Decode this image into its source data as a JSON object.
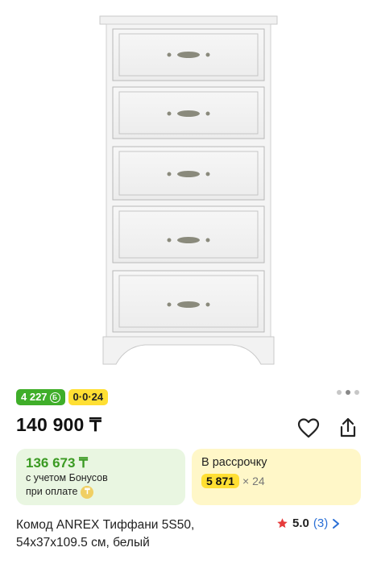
{
  "product": {
    "image_alt": "Комод ANREX Тиффани 5S50",
    "bonus_badge": "4 227",
    "installment_badge": "0·0·24",
    "price": "140 900 ₸",
    "title": "Комод ANREX Тиффани 5S50, 54x37x109.5 см, белый"
  },
  "bonus_card": {
    "price": "136 673 ₸",
    "line1": "с учетом Бонусов",
    "line2": "при оплате"
  },
  "installment_card": {
    "title": "В рассрочку",
    "amount": "5 871",
    "months": "× 24"
  },
  "rating": {
    "score": "5.0",
    "count": "(3)"
  },
  "gallery": {
    "total": 3,
    "active": 1
  },
  "colors": {
    "green": "#3fae29",
    "yellow": "#ffdf33",
    "star": "#e63b3b",
    "link": "#2a6fd6"
  }
}
